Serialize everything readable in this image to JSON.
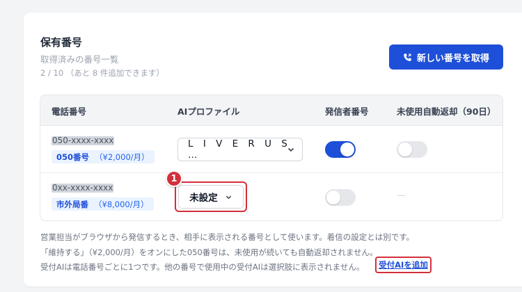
{
  "section": {
    "title": "保有番号",
    "subtitle": "取得済みの番号一覧",
    "quota": "2 / 10 （あと 8 件追加できます）",
    "new_number_button": "新しい番号を取得"
  },
  "table": {
    "headers": [
      "電話番号",
      "AIプロファイル",
      "発信者番号",
      "未使用自動返却（90日）"
    ],
    "rows": [
      {
        "number": "050-xxxx-xxxx",
        "type": "050番号",
        "price": "（¥2,000/月）",
        "profile": "L I V E   R U S …",
        "caller_id_on": true,
        "auto_return": "off"
      },
      {
        "number": "0xx-xxxx-xxxx",
        "type": "市外局番",
        "price": "（¥8,000/月）",
        "profile": "未設定",
        "caller_id_on": false,
        "auto_return": "—"
      }
    ]
  },
  "annotation_marker": "1",
  "footnotes": [
    "営業担当がブラウザから発信するとき、相手に表示される番号として使います。着信の設定とは別です。",
    "「維持する」（¥2,000/月）をオンにした050番号は、未使用が続いても自動返却されません。",
    "受付AIは電話番号ごとに1つです。他の番号で使用中の受付AIは選択肢に表示されません。"
  ],
  "add_link": "受付AIを追加",
  "colors": {
    "primary": "#1d4fd8",
    "highlight": "#d32f3a",
    "badge_bg": "#eaf3ff"
  }
}
